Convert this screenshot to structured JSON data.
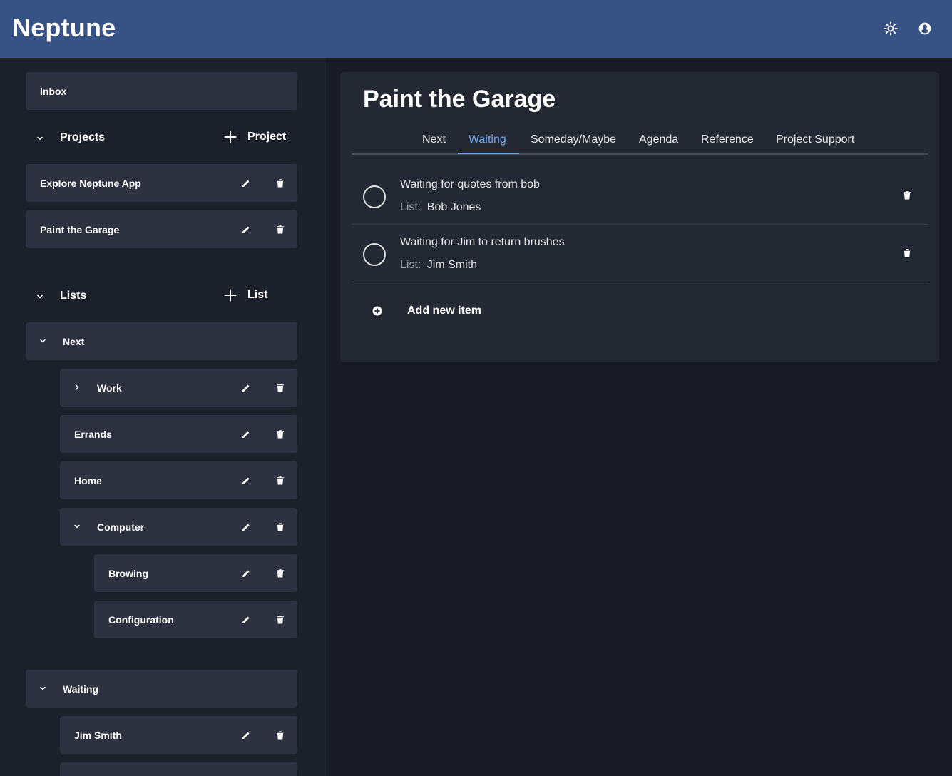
{
  "header": {
    "app_name": "Neptune",
    "brightness_icon": "brightness-icon",
    "account_icon": "account-circle-icon",
    "bg_color": "#375285"
  },
  "sidebar": {
    "inbox_label": "Inbox",
    "projects": {
      "title": "Projects",
      "add_label": "Project",
      "items": [
        {
          "label": "Explore Neptune App"
        },
        {
          "label": "Paint the Garage"
        }
      ]
    },
    "lists": {
      "title": "Lists",
      "add_label": "List",
      "groups": [
        {
          "label": "Next",
          "children": [
            {
              "label": "Work"
            },
            {
              "label": "Errands"
            },
            {
              "label": "Home"
            },
            {
              "label": "Computer"
            },
            {
              "label": "Browing"
            },
            {
              "label": "Configuration"
            }
          ]
        },
        {
          "label": "Waiting",
          "children": [
            {
              "label": "Jim Smith"
            }
          ]
        }
      ]
    }
  },
  "main": {
    "title": "Paint the Garage",
    "tabs": [
      {
        "label": "Next"
      },
      {
        "label": "Waiting",
        "active": true
      },
      {
        "label": "Someday/Maybe"
      },
      {
        "label": "Agenda"
      },
      {
        "label": "Reference"
      },
      {
        "label": "Project Support"
      }
    ],
    "items": [
      {
        "title": "Waiting for quotes from bob",
        "list_key": "List:",
        "list_value": "Bob Jones"
      },
      {
        "title": "Waiting for Jim to return brushes",
        "list_key": "List:",
        "list_value": "Jim Smith"
      }
    ],
    "add_item_label": "Add new item",
    "accent_color": "#6ea8f2"
  }
}
